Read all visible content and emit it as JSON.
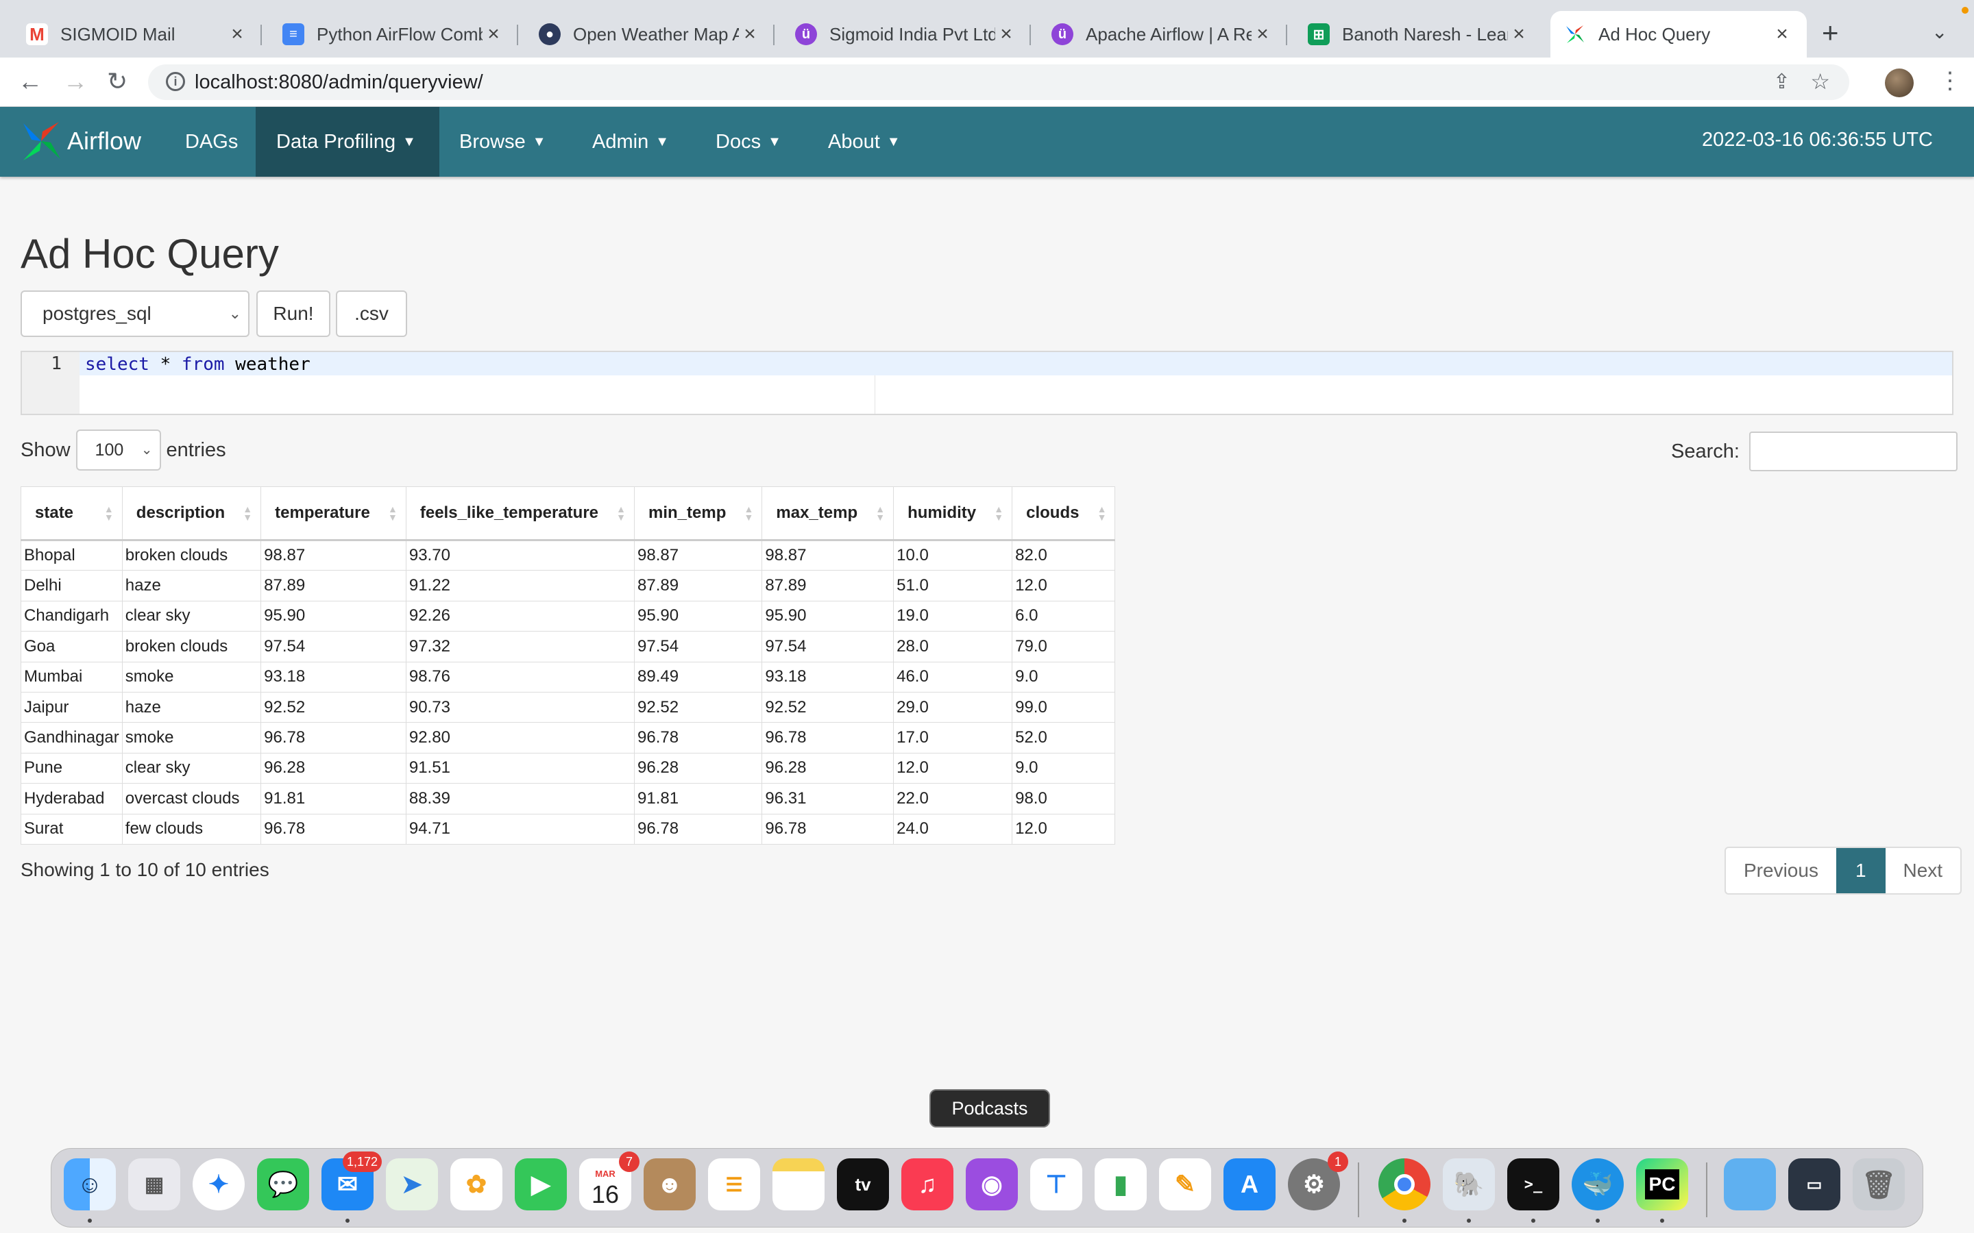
{
  "browser": {
    "tabs": [
      {
        "title": "SIGMOID Mail"
      },
      {
        "title": "Python AirFlow Comb"
      },
      {
        "title": "Open Weather Map A"
      },
      {
        "title": "Sigmoid India Pvt Ltd"
      },
      {
        "title": "Apache Airflow | A Re"
      },
      {
        "title": "Banoth Naresh - Lear"
      },
      {
        "title": "Ad Hoc Query"
      }
    ],
    "url": "localhost:8080/admin/queryview/"
  },
  "navbar": {
    "brand": "Airflow",
    "items": [
      {
        "label": "DAGs"
      },
      {
        "label": "Data Profiling"
      },
      {
        "label": "Browse"
      },
      {
        "label": "Admin"
      },
      {
        "label": "Docs"
      },
      {
        "label": "About"
      }
    ],
    "clock": "2022-03-16 06:36:55 UTC",
    "color": "#2e7585"
  },
  "page": {
    "title": "Ad Hoc Query",
    "connection": "postgres_sql",
    "run_label": "Run!",
    "csv_label": ".csv",
    "line_number": "1",
    "query_kw1": "select",
    "query_mid": " * ",
    "query_kw2": "from",
    "query_rest": " weather"
  },
  "table_controls": {
    "show_label": "Show",
    "page_length": "100",
    "entries_label": "entries",
    "search_label": "Search:"
  },
  "results": {
    "columns": [
      "state",
      "description",
      "temperature",
      "feels_like_temperature",
      "min_temp",
      "max_temp",
      "humidity",
      "clouds"
    ],
    "rows": [
      [
        "Bhopal",
        "broken clouds",
        "98.87",
        "93.70",
        "98.87",
        "98.87",
        "10.0",
        "82.0"
      ],
      [
        "Delhi",
        "haze",
        "87.89",
        "91.22",
        "87.89",
        "87.89",
        "51.0",
        "12.0"
      ],
      [
        "Chandigarh",
        "clear sky",
        "95.90",
        "92.26",
        "95.90",
        "95.90",
        "19.0",
        "6.0"
      ],
      [
        "Goa",
        "broken clouds",
        "97.54",
        "97.32",
        "97.54",
        "97.54",
        "28.0",
        "79.0"
      ],
      [
        "Mumbai",
        "smoke",
        "93.18",
        "98.76",
        "89.49",
        "93.18",
        "46.0",
        "9.0"
      ],
      [
        "Jaipur",
        "haze",
        "92.52",
        "90.73",
        "92.52",
        "92.52",
        "29.0",
        "99.0"
      ],
      [
        "Gandhinagar",
        "smoke",
        "96.78",
        "92.80",
        "96.78",
        "96.78",
        "17.0",
        "52.0"
      ],
      [
        "Pune",
        "clear sky",
        "96.28",
        "91.51",
        "96.28",
        "96.28",
        "12.0",
        "9.0"
      ],
      [
        "Hyderabad",
        "overcast clouds",
        "91.81",
        "88.39",
        "91.81",
        "96.31",
        "22.0",
        "98.0"
      ],
      [
        "Surat",
        "few clouds",
        "96.78",
        "94.71",
        "96.78",
        "96.78",
        "24.0",
        "12.0"
      ]
    ],
    "info": "Showing 1 to 10 of 10 entries",
    "pager": {
      "previous": "Previous",
      "current": "1",
      "next": "Next"
    }
  },
  "dock": {
    "tooltip": "Podcasts",
    "mail_badge": "1,172",
    "calendar_month": "MAR",
    "calendar_day": "16",
    "calendar_badge": "7",
    "settings_badge": "1",
    "apps": [
      "finder-icon",
      "launchpad-icon",
      "safari-icon",
      "messages-icon",
      "mail-icon",
      "maps-icon",
      "photos-icon",
      "facetime-icon",
      "calendar-icon",
      "contacts-icon",
      "reminders-icon",
      "notes-icon",
      "tv-icon",
      "music-icon",
      "podcasts-icon",
      "keynote-icon",
      "numbers-icon",
      "pages-icon",
      "appstore-icon",
      "settings-icon",
      "chrome-icon",
      "postgres-icon",
      "terminal-icon",
      "docker-icon",
      "pycharm-icon",
      "folder-icon",
      "screenshot-icon",
      "trash-icon"
    ]
  }
}
